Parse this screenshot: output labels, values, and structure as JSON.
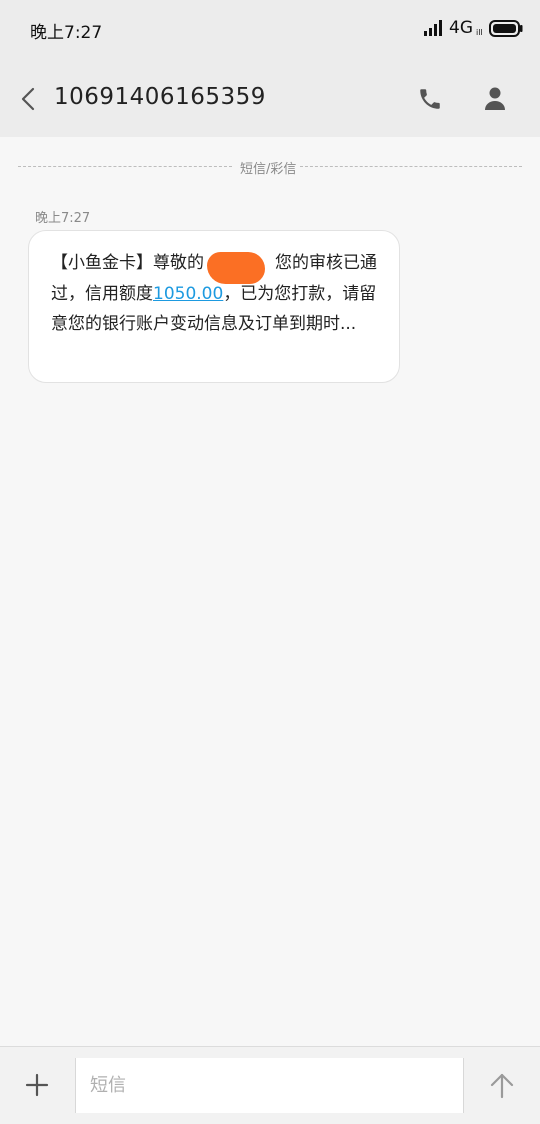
{
  "status_bar": {
    "time": "晚上7:27",
    "network": "4G",
    "network_sub": "ill",
    "icons": [
      "signal-icon",
      "battery-icon"
    ]
  },
  "header": {
    "contact_number": "10691406165359",
    "icons": [
      "back-icon",
      "phone-icon",
      "person-icon"
    ]
  },
  "divider": {
    "label": "短信/彩信"
  },
  "message": {
    "time": "晚上7:27",
    "text_before": "【小鱼金卡】尊敬的",
    "redacted_name_placeholder": "",
    "text_middle": "，您的审核已通过，信用额度",
    "amount": "1050.00",
    "text_after": "，已为您打款，请留意您的银行账户变动信息及订单到期时..."
  },
  "input_bar": {
    "placeholder": "短信",
    "icons": [
      "plus-icon",
      "send-icon"
    ]
  },
  "colors": {
    "header_bg": "#ececec",
    "page_bg": "#f7f7f7",
    "link": "#1d9ae0",
    "redaction": "#fb6f24"
  }
}
